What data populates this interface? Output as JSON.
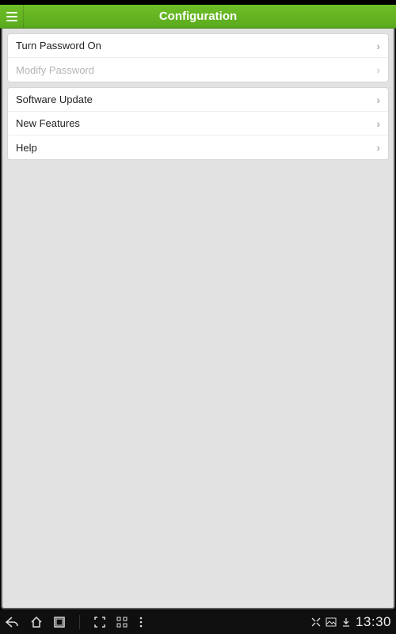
{
  "header": {
    "title": "Configuration"
  },
  "groups": [
    {
      "items": [
        {
          "label": "Turn Password On",
          "disabled": false
        },
        {
          "label": "Modify Password",
          "disabled": true
        }
      ]
    },
    {
      "items": [
        {
          "label": "Software Update",
          "disabled": false
        },
        {
          "label": "New Features",
          "disabled": false
        },
        {
          "label": "Help",
          "disabled": false
        }
      ]
    }
  ],
  "navbar": {
    "time": "13:30"
  }
}
